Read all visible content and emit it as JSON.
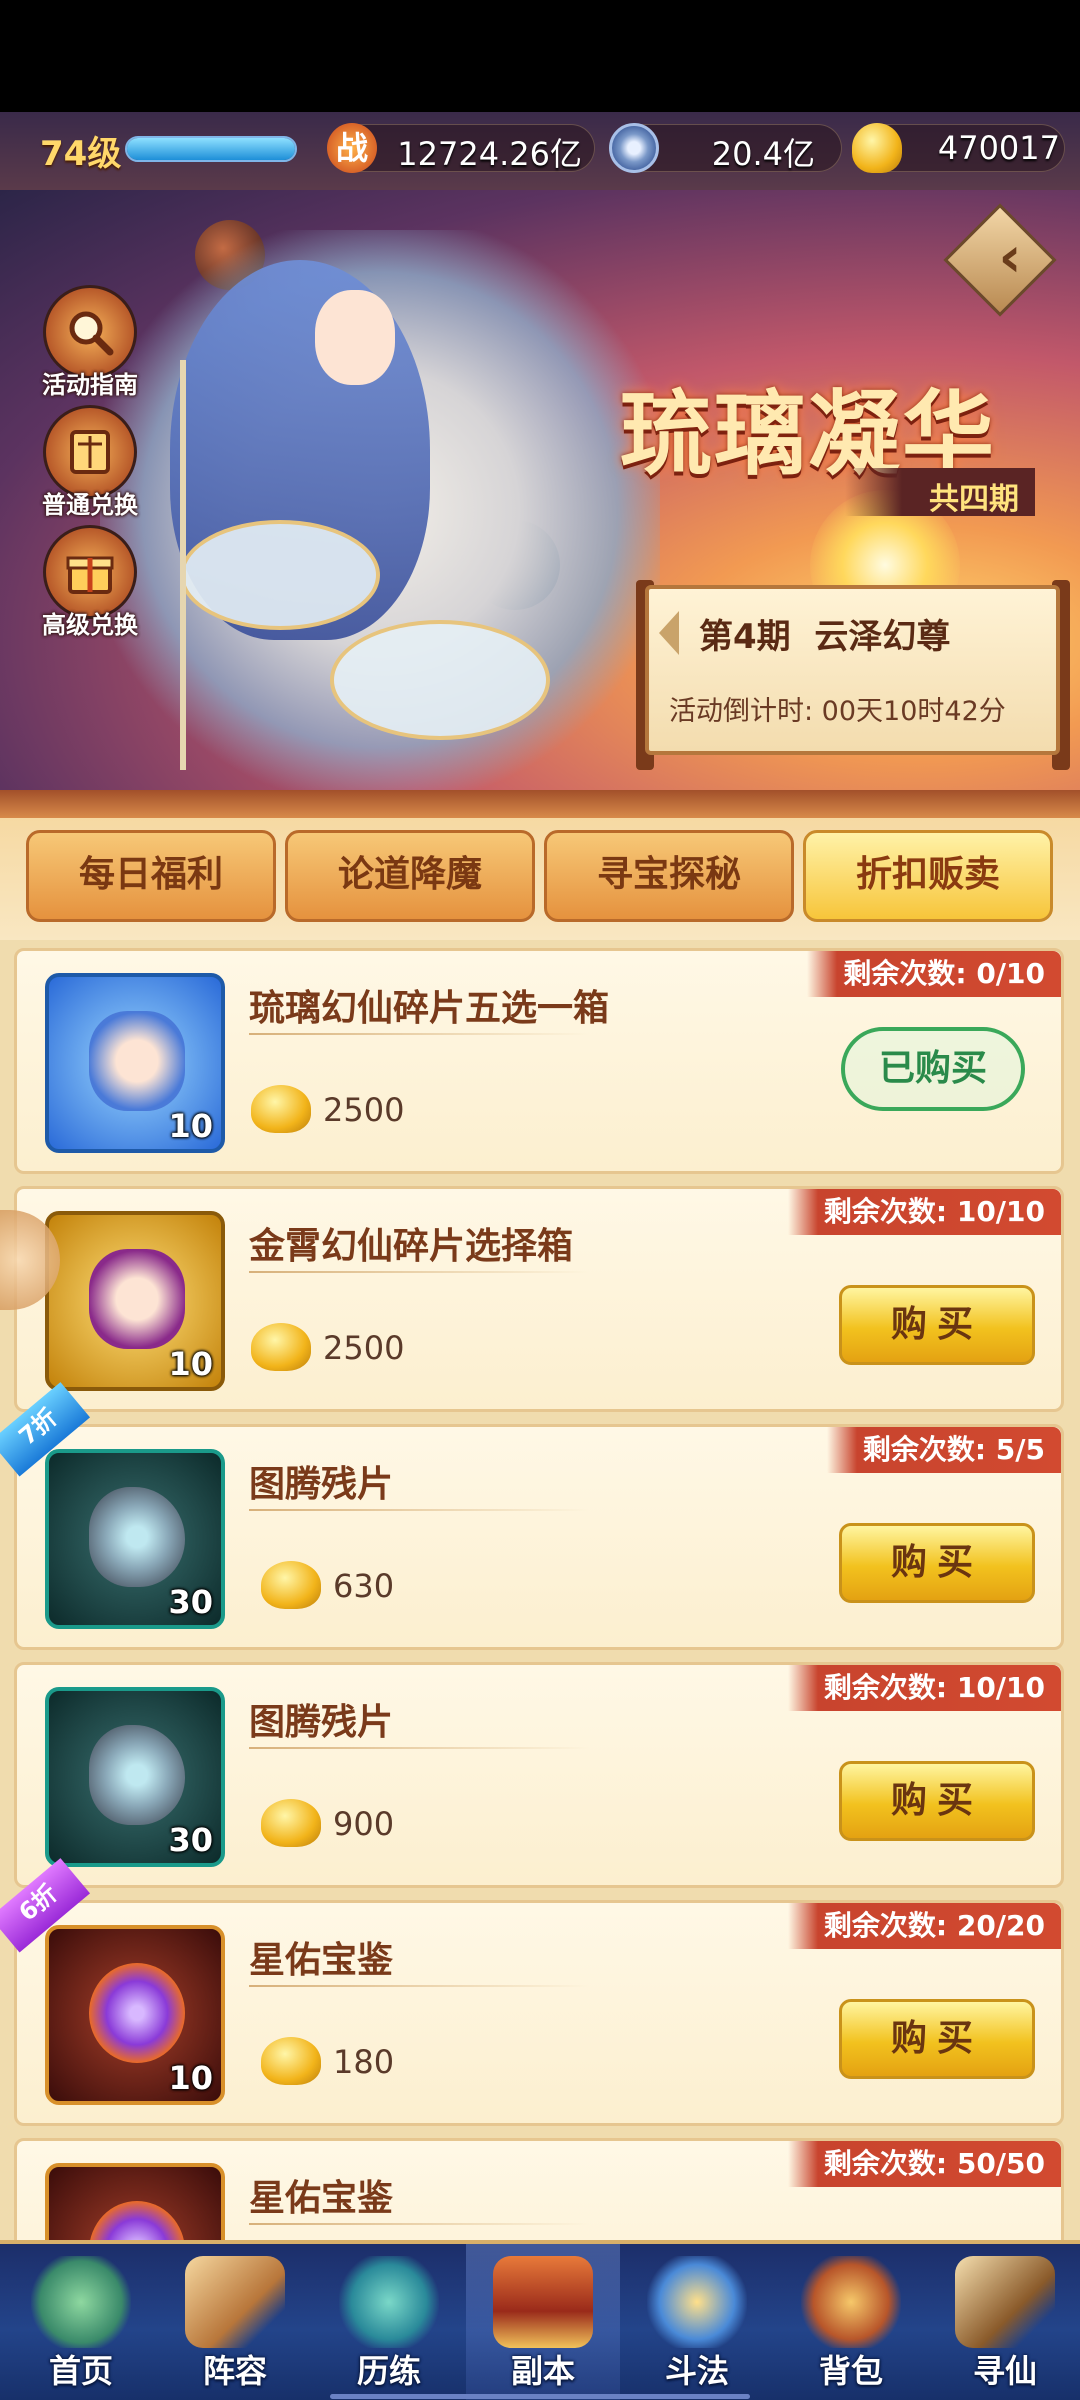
{
  "resource_bar": {
    "level": "74级",
    "exp_progress": 1.0,
    "power_icon": "战",
    "power": "12724.26亿",
    "silver": "20.4亿",
    "gold": "470017"
  },
  "banner": {
    "side_buttons": [
      {
        "label": "活动指南",
        "icon": "magnifier-icon"
      },
      {
        "label": "普通兑换",
        "icon": "scroll-icon"
      },
      {
        "label": "高级兑换",
        "icon": "giftbox-icon"
      }
    ],
    "title": "琉璃凝华",
    "subtitle": "共四期",
    "period_label": "第4期",
    "period_name": "云泽幻尊",
    "countdown": "活动倒计时: 00天10时42分"
  },
  "tabs": [
    {
      "label": "每日福利",
      "active": false
    },
    {
      "label": "论道降魔",
      "active": false
    },
    {
      "label": "寻宝探秘",
      "active": false
    },
    {
      "label": "折扣贩卖",
      "active": true
    }
  ],
  "items": [
    {
      "name": "琉璃幻仙碎片五选一箱",
      "qty": "10",
      "price": "2500",
      "remaining": "剩余次数: 0/10",
      "status": "已购买",
      "discount": ""
    },
    {
      "name": "金霄幻仙碎片选择箱",
      "qty": "10",
      "price": "2500",
      "remaining": "剩余次数: 10/10",
      "status": "购买",
      "discount": ""
    },
    {
      "name": "图腾残片",
      "qty": "30",
      "price": "630",
      "remaining": "剩余次数: 5/5",
      "status": "购买",
      "discount": "7折"
    },
    {
      "name": "图腾残片",
      "qty": "30",
      "price": "900",
      "remaining": "剩余次数: 10/10",
      "status": "购买",
      "discount": ""
    },
    {
      "name": "星佑宝鉴",
      "qty": "10",
      "price": "180",
      "remaining": "剩余次数: 20/20",
      "status": "购买",
      "discount": "6折"
    },
    {
      "name": "星佑宝鉴",
      "qty": "",
      "price": "",
      "remaining": "剩余次数: 50/50",
      "status": "",
      "discount": ""
    }
  ],
  "bottom_nav": [
    {
      "label": "首页",
      "icon": "home-island-icon"
    },
    {
      "label": "阵容",
      "icon": "lineup-cards-icon"
    },
    {
      "label": "历练",
      "icon": "training-icon"
    },
    {
      "label": "副本",
      "icon": "dungeon-gate-icon",
      "active": true
    },
    {
      "label": "斗法",
      "icon": "battle-icon"
    },
    {
      "label": "背包",
      "icon": "bag-icon"
    },
    {
      "label": "寻仙",
      "icon": "scroll-search-icon"
    }
  ],
  "colors": {
    "accent_gold": "#f2c21e",
    "remain_tag": "#d24a30",
    "bought_green": "#2a8a4a",
    "nav_blue": "#23448a"
  }
}
